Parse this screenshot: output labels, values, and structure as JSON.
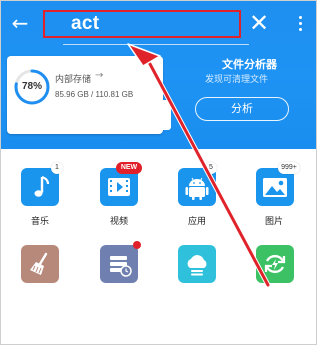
{
  "search": {
    "query": "act"
  },
  "storage": {
    "percent_label": "78%",
    "percent": 78,
    "title": "内部存储",
    "used": "85.96 GB",
    "total": "110.81 GB"
  },
  "analyzer": {
    "title": "文件分析器",
    "subtitle": "发现可清理文件",
    "button_label": "分析"
  },
  "grid": {
    "music": {
      "label": "音乐",
      "badge": "1"
    },
    "video": {
      "label": "视频",
      "badge": "NEW"
    },
    "apps": {
      "label": "应用",
      "badge": "5"
    },
    "pictures": {
      "label": "图片",
      "badge": "999+"
    }
  },
  "colors": {
    "accent": "#1e90f2",
    "annotation": "#e0232a",
    "music_tile": "#1a95ee",
    "video_tile": "#1a95ee",
    "apps_tile": "#1a95ee",
    "pictures_tile": "#1a95ee",
    "cleaner_tile": "#b6897a",
    "stack_tile": "#6e7fb0",
    "cloud_tile": "#2fc1dc",
    "sync_tile": "#3cc264"
  },
  "icons": {
    "back": "back-arrow-icon",
    "clear": "close-icon",
    "more": "more-vertical-icon",
    "music": "music-note-icon",
    "video": "video-play-icon",
    "apps": "android-icon",
    "pictures": "picture-icon",
    "cleaner": "broom-icon",
    "stack": "stack-clock-icon",
    "cloud": "cloud-icon",
    "sync": "sync-icon"
  }
}
